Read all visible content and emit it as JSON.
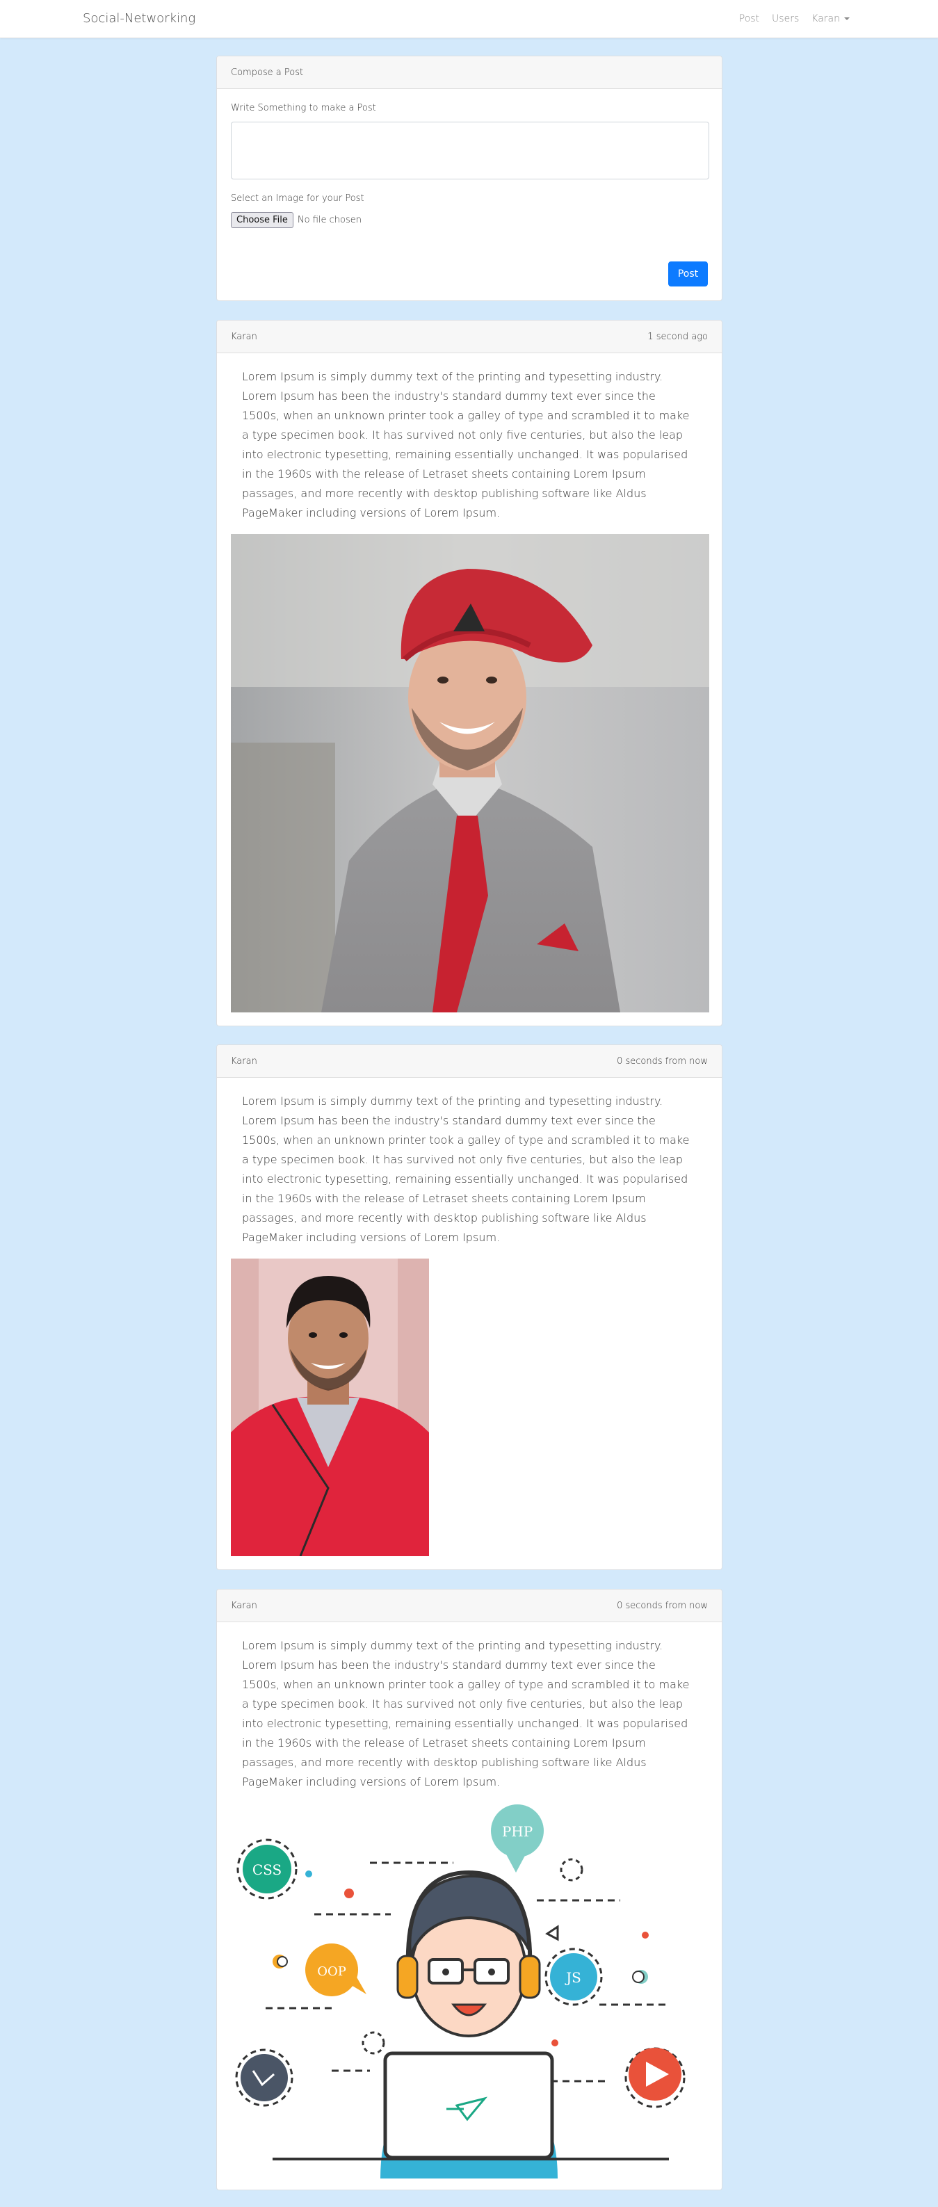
{
  "navbar": {
    "brand": "Social-Networking",
    "links": [
      "Post",
      "Users",
      "Karan"
    ]
  },
  "compose": {
    "header": "Compose a Post",
    "text_label": "Write Something to make a Post",
    "image_label": "Select an Image for your Post",
    "file_button": "Choose File",
    "file_status": "No file chosen",
    "submit_label": "Post"
  },
  "posts": [
    {
      "author": "Karan",
      "time": "1 second ago",
      "body": "Lorem Ipsum is simply dummy text of the printing and typesetting industry. Lorem Ipsum has been the industry's standard dummy text ever since the 1500s, when an unknown printer took a galley of type and scrambled it to make a type specimen book. It has survived not only five centuries, but also the leap into electronic typesetting, remaining essentially unchanged. It was popularised in the 1960s with the release of Letraset sheets containing Lorem Ipsum passages, and more recently with desktop publishing software like Aldus PageMaker including versions of Lorem Ipsum."
    },
    {
      "author": "Karan",
      "time": "0 seconds from now",
      "body": "Lorem Ipsum is simply dummy text of the printing and typesetting industry. Lorem Ipsum has been the industry's standard dummy text ever since the 1500s, when an unknown printer took a galley of type and scrambled it to make a type specimen book. It has survived not only five centuries, but also the leap into electronic typesetting, remaining essentially unchanged. It was popularised in the 1960s with the release of Letraset sheets containing Lorem Ipsum passages, and more recently with desktop publishing software like Aldus PageMaker including versions of Lorem Ipsum."
    },
    {
      "author": "Karan",
      "time": "0 seconds from now",
      "body": "Lorem Ipsum is simply dummy text of the printing and typesetting industry. Lorem Ipsum has been the industry's standard dummy text ever since the 1500s, when an unknown printer took a galley of type and scrambled it to make a type specimen book. It has survived not only five centuries, but also the leap into electronic typesetting, remaining essentially unchanged. It was popularised in the 1960s with the release of Letraset sheets containing Lorem Ipsum passages, and more recently with desktop publishing software like Aldus PageMaker including versions of Lorem Ipsum."
    }
  ],
  "illustration_badges": [
    "CSS",
    "PHP",
    "JS",
    "OOP"
  ],
  "colors": {
    "page_background": "#d3e9fb",
    "primary_button": "#0d7bff"
  }
}
